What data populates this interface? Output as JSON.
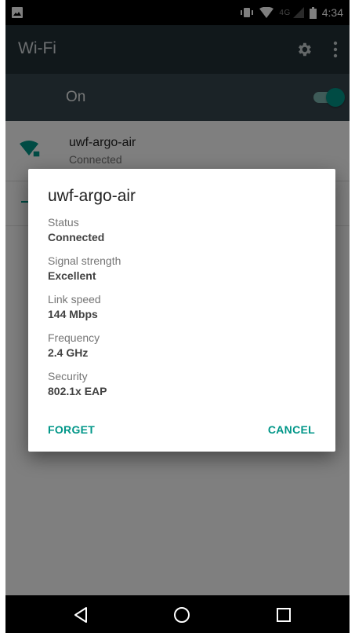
{
  "status_bar": {
    "network": "4G",
    "time": "4:34"
  },
  "app_bar": {
    "title": "Wi-Fi"
  },
  "wifi_toggle": {
    "label": "On",
    "enabled": true
  },
  "network_list": [
    {
      "name": "uwf-argo-air",
      "status": "Connected"
    }
  ],
  "dialog": {
    "title": "uwf-argo-air",
    "fields": [
      {
        "label": "Status",
        "value": "Connected"
      },
      {
        "label": "Signal strength",
        "value": "Excellent"
      },
      {
        "label": "Link speed",
        "value": "144 Mbps"
      },
      {
        "label": "Frequency",
        "value": "2.4 GHz"
      },
      {
        "label": "Security",
        "value": "802.1x EAP"
      }
    ],
    "buttons": {
      "forget": "FORGET",
      "cancel": "CANCEL"
    }
  },
  "colors": {
    "accent": "#009688",
    "appbar": "#223137",
    "toggle_row": "#37474f"
  },
  "icons": [
    "image-icon",
    "vibrate-icon",
    "wifi-signal-icon",
    "cell-signal-icon",
    "battery-icon",
    "gear-icon",
    "more-vert-icon",
    "wifi-lock-icon",
    "back-icon",
    "home-icon",
    "recents-icon"
  ]
}
